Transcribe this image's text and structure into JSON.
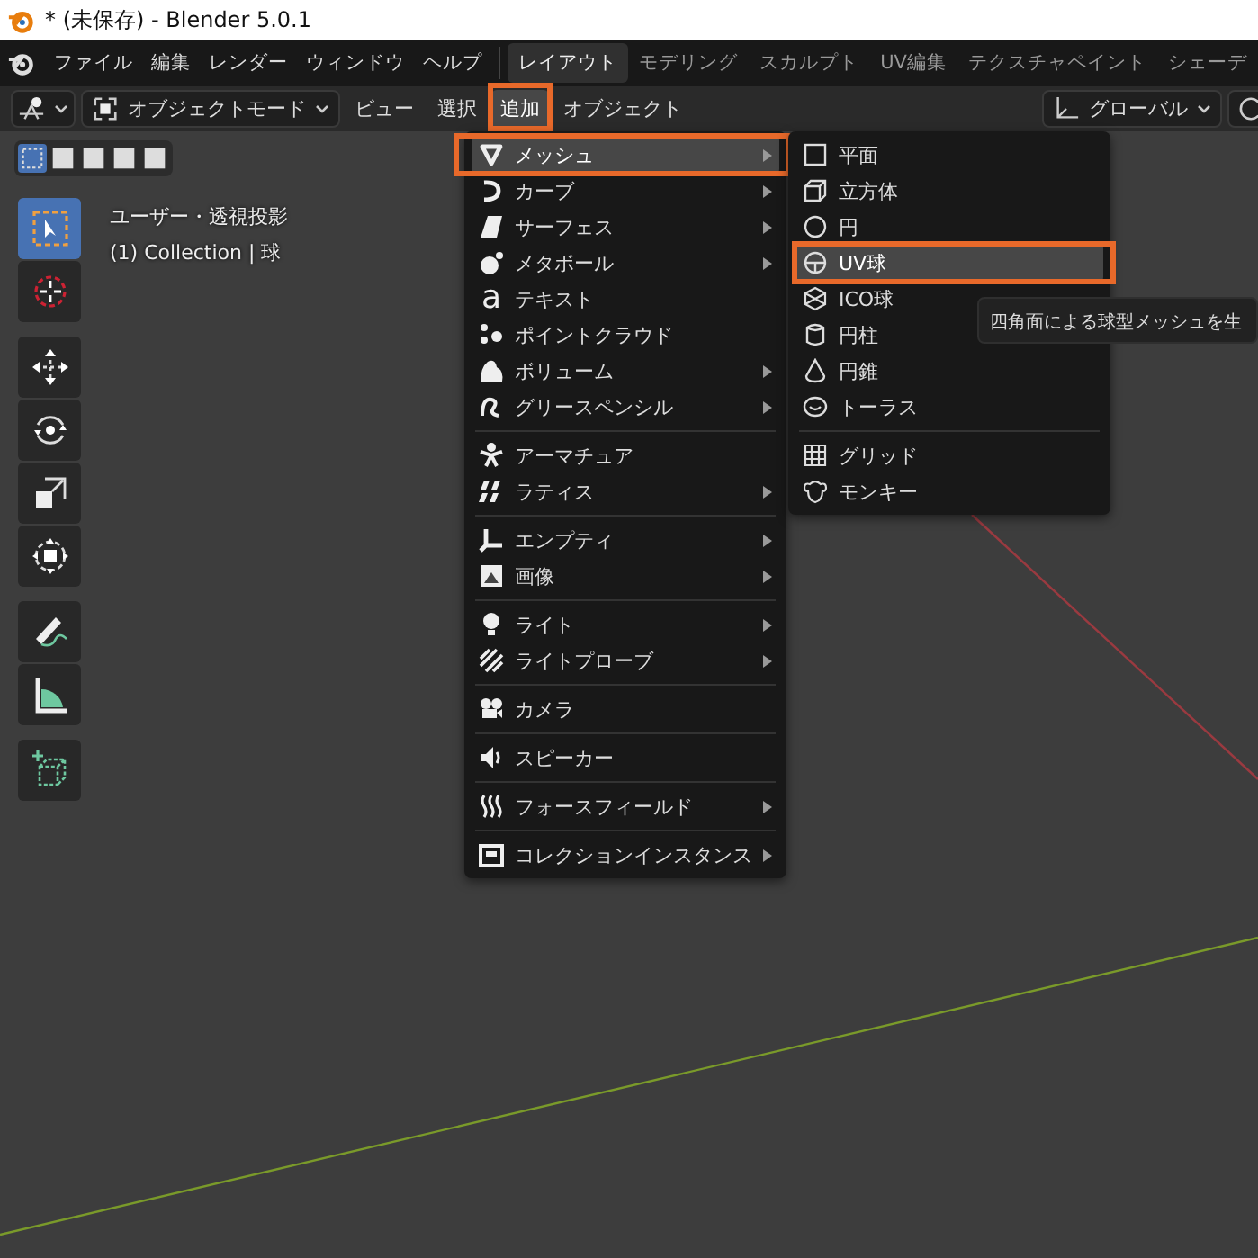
{
  "window": {
    "title": "* (未保存) - Blender 5.0.1"
  },
  "menubar": {
    "menus": [
      "ファイル",
      "編集",
      "レンダー",
      "ウィンドウ",
      "ヘルプ"
    ]
  },
  "workspaces": [
    {
      "label": "レイアウト",
      "selected": true
    },
    {
      "label": "モデリング",
      "selected": false
    },
    {
      "label": "スカルプト",
      "selected": false
    },
    {
      "label": "UV編集",
      "selected": false
    },
    {
      "label": "テクスチャペイント",
      "selected": false
    },
    {
      "label": "シェーデ",
      "selected": false
    }
  ],
  "header": {
    "mode": "オブジェクトモード",
    "orientation": "グローバル",
    "menus": [
      {
        "label": "ビュー",
        "selected": false,
        "annotated": false
      },
      {
        "label": "選択",
        "selected": false,
        "annotated": false
      },
      {
        "label": "追加",
        "selected": true,
        "annotated": true
      },
      {
        "label": "オブジェクト",
        "selected": false,
        "annotated": false
      }
    ]
  },
  "select_modes": [
    {
      "selected": true
    },
    {
      "selected": false
    },
    {
      "selected": false
    },
    {
      "selected": false
    },
    {
      "selected": false
    }
  ],
  "viewport": {
    "view_name": "ユーザー・透視投影",
    "collection": "(1) Collection | 球"
  },
  "tools": [
    [
      {
        "selected": true
      },
      {
        "selected": false
      }
    ],
    [
      {
        "selected": false
      },
      {
        "selected": false
      },
      {
        "selected": false
      },
      {
        "selected": false
      }
    ],
    [
      {
        "selected": false
      },
      {
        "selected": false
      }
    ],
    [
      {
        "selected": false
      }
    ]
  ],
  "add_menu": {
    "groups": [
      [
        {
          "label": "メッシュ",
          "submenu": true,
          "selected": true,
          "annotated": true
        },
        {
          "label": "カーブ",
          "submenu": true,
          "selected": false,
          "annotated": false
        },
        {
          "label": "サーフェス",
          "submenu": true,
          "selected": false,
          "annotated": false
        },
        {
          "label": "メタボール",
          "submenu": true,
          "selected": false,
          "annotated": false
        },
        {
          "label": "テキスト",
          "glyph": "a",
          "submenu": false,
          "selected": false,
          "annotated": false
        },
        {
          "label": "ポイントクラウド",
          "submenu": false,
          "selected": false,
          "annotated": false
        },
        {
          "label": "ボリューム",
          "submenu": true,
          "selected": false,
          "annotated": false
        },
        {
          "label": "グリースペンシル",
          "submenu": true,
          "selected": false,
          "annotated": false
        }
      ],
      [
        {
          "label": "アーマチュア",
          "submenu": false,
          "selected": false,
          "annotated": false
        },
        {
          "label": "ラティス",
          "submenu": true,
          "selected": false,
          "annotated": false
        }
      ],
      [
        {
          "label": "エンプティ",
          "submenu": true,
          "selected": false,
          "annotated": false
        },
        {
          "label": "画像",
          "submenu": true,
          "selected": false,
          "annotated": false
        }
      ],
      [
        {
          "label": "ライト",
          "submenu": true,
          "selected": false,
          "annotated": false
        },
        {
          "label": "ライトプローブ",
          "submenu": true,
          "selected": false,
          "annotated": false
        }
      ],
      [
        {
          "label": "カメラ",
          "submenu": false,
          "selected": false,
          "annotated": false
        }
      ],
      [
        {
          "label": "スピーカー",
          "submenu": false,
          "selected": false,
          "annotated": false
        }
      ],
      [
        {
          "label": "フォースフィールド",
          "submenu": true,
          "selected": false,
          "annotated": false
        }
      ],
      [
        {
          "label": "コレクションインスタンス",
          "submenu": true,
          "selected": false,
          "annotated": false
        }
      ]
    ]
  },
  "mesh_menu": {
    "groups": [
      [
        {
          "label": "平面",
          "selected": false,
          "annotated": false
        },
        {
          "label": "立方体",
          "selected": false,
          "annotated": false
        },
        {
          "label": "円",
          "selected": false,
          "annotated": false
        },
        {
          "label": "UV球",
          "selected": true,
          "annotated": true
        },
        {
          "label": "ICO球",
          "selected": false,
          "annotated": false
        },
        {
          "label": "円柱",
          "selected": false,
          "annotated": false
        },
        {
          "label": "円錐",
          "selected": false,
          "annotated": false
        },
        {
          "label": "トーラス",
          "selected": false,
          "annotated": false
        }
      ],
      [
        {
          "label": "グリッド",
          "selected": false,
          "annotated": false
        },
        {
          "label": "モンキー",
          "selected": false,
          "annotated": false
        }
      ]
    ]
  },
  "tooltip": "四角面による球型メッシュを生"
}
